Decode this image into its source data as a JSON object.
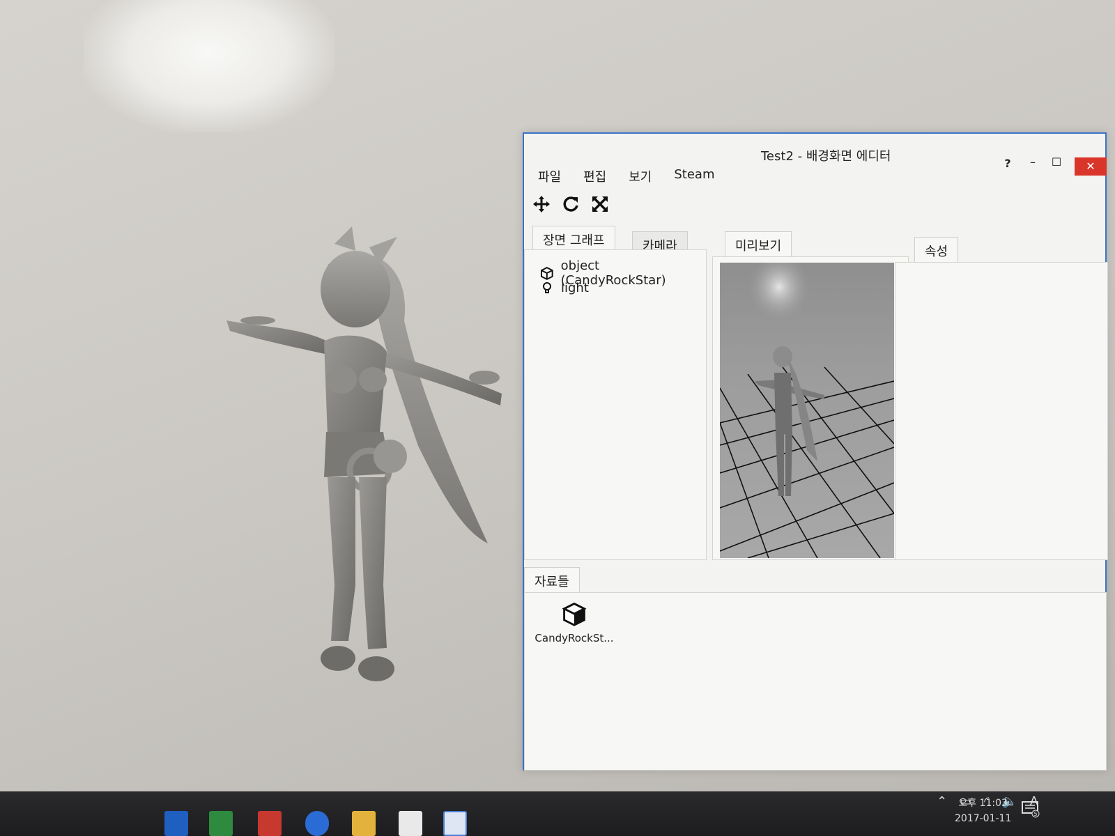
{
  "window": {
    "title": "Test2 - 배경화면 에디터",
    "help_label": "?",
    "minimize_label": "–",
    "maximize_label": "☐",
    "close_label": "✕"
  },
  "menu": {
    "items": [
      "파일",
      "편집",
      "보기",
      "Steam"
    ]
  },
  "toolbar": {
    "tools": [
      "move-icon",
      "rotate-icon",
      "scale-icon"
    ]
  },
  "scene_panel": {
    "tabs": [
      "장면 그래프",
      "카메라"
    ],
    "items": [
      {
        "label": "object (CandyRockStar)",
        "icon": "cube-icon"
      },
      {
        "label": "light",
        "icon": "lightbulb-icon"
      }
    ]
  },
  "preview_panel": {
    "tab": "미리보기"
  },
  "properties_panel": {
    "tab": "속성"
  },
  "assets_panel": {
    "tab": "자료들",
    "items": [
      {
        "label": "CandyRockSt...",
        "icon": "cube-icon"
      }
    ]
  },
  "taskbar": {
    "tray_icons": [
      "chevron-up-icon",
      "battery-icon",
      "wifi-icon",
      "volume-icon"
    ],
    "ime": "A",
    "clock_time": "오후 11:03",
    "clock_date": "2017-01-11",
    "notification_count": "5"
  },
  "colors": {
    "window_border": "#3b73c8",
    "close_button": "#d9352a",
    "taskbar": "#1d1d1f"
  }
}
